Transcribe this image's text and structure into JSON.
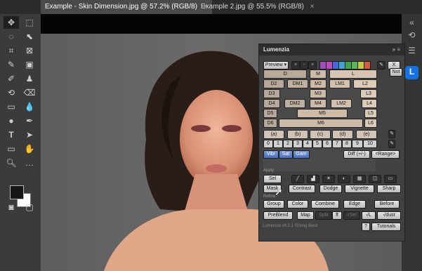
{
  "tabs": [
    {
      "label": "Example - Skin Dimension.jpg @ 57.2% (RGB/8)",
      "close": "×"
    },
    {
      "label": "Example 2.jpg @ 55.5% (RGB/8)",
      "close": "×"
    }
  ],
  "panel": {
    "title": "Lumenzia",
    "preview_label": "Preview",
    "toolbar_btns": [
      "+",
      "-",
      "+"
    ],
    "swatch_colors": [
      "#9b4fb8",
      "#c24ac0",
      "#3f6ad9",
      "#3fa2d8",
      "#45a449",
      "#56b85a",
      "#c9c640",
      "#d35c3c"
    ],
    "x_label": "X",
    "not_label": "Not",
    "rows": [
      [
        "D",
        "M",
        "L"
      ],
      [
        "D2",
        "DM1",
        "M2",
        "LM1",
        "L2"
      ],
      [
        "D3",
        "M3",
        "L3"
      ],
      [
        "D4",
        "DM2",
        "M4",
        "LM2",
        "L4"
      ],
      [
        "D5",
        "M5",
        "L5"
      ],
      [
        "D6",
        "M6",
        "L6"
      ]
    ],
    "paren_row": [
      "(a)",
      "(b)",
      "(c)",
      "(d)",
      "(e)"
    ],
    "zone_numbers": [
      "0",
      "1",
      "2",
      "3",
      "4",
      "5",
      "6",
      "7",
      "8",
      "9",
      "10"
    ],
    "vibr": "Vibr",
    "sat": "Sat",
    "gam": "Gam",
    "diff": "Diff (+/-)",
    "range": "<Range>",
    "apply_label": "Apply",
    "sel": "Sel",
    "mask": "Mask",
    "contrast": "Contrast",
    "dodge": "Dodge",
    "vignette": "Vignette",
    "sharp": "Sharp",
    "refine_label": "Refine",
    "group": "Group",
    "color": "Color",
    "combine": "Combine",
    "edge": "Edge",
    "before": "Before",
    "preblend": "PreBlend",
    "map": "Map",
    "split": "Split",
    "ff": "ff",
    "vsel": "√Sel",
    "vl": "√L",
    "vdust": "√dust",
    "help": "?",
    "tutorials": "Tutorials",
    "footer": "Lumenzia v9.2.1 ©Greg Benz"
  },
  "colors": {
    "app_bg": "#535353",
    "panel_bg": "#414141",
    "accent_blue": "#1473e6"
  }
}
